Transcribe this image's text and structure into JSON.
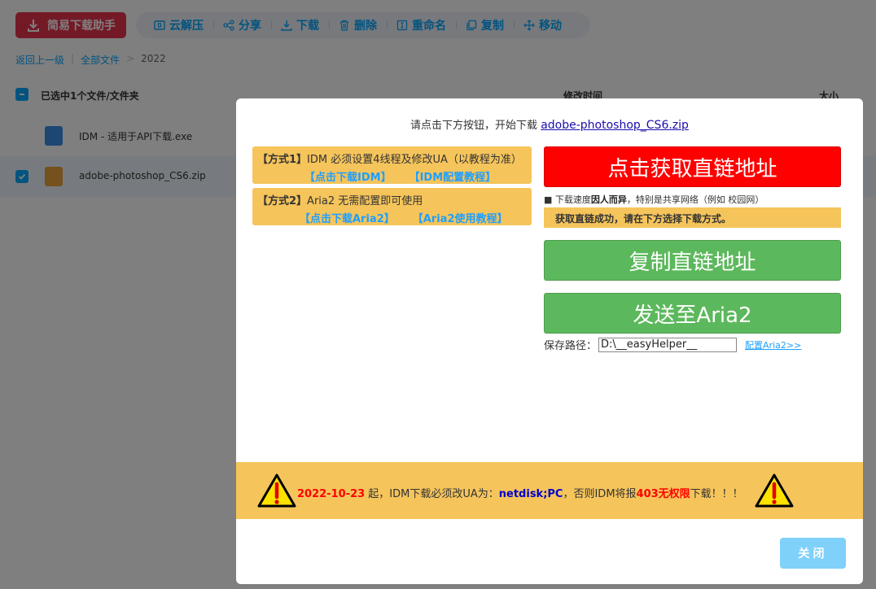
{
  "toolbar": {
    "main_button": "简易下载助手",
    "actions": [
      {
        "label": "云解压",
        "icon": "archive-icon"
      },
      {
        "label": "分享",
        "icon": "share-icon"
      },
      {
        "label": "下载",
        "icon": "download-icon"
      },
      {
        "label": "删除",
        "icon": "trash-icon"
      },
      {
        "label": "重命名",
        "icon": "rename-icon"
      },
      {
        "label": "复制",
        "icon": "copy-icon"
      },
      {
        "label": "移动",
        "icon": "move-icon"
      }
    ]
  },
  "breadcrumb": {
    "back": "返回上一级",
    "sep": "|",
    "all": "全部文件",
    "arrow": ">",
    "current": "2022"
  },
  "list": {
    "selected_text": "已选中1个文件/文件夹",
    "col_mtime": "修改时间",
    "col_size": "大小",
    "files": [
      {
        "name": "IDM - 适用于API下载.exe",
        "selected": false
      },
      {
        "name": "adobe-photoshop_CS6.zip",
        "selected": true
      }
    ]
  },
  "modal": {
    "prompt": "请点击下方按钮，开始下载",
    "filename": "adobe-photoshop_CS6.zip",
    "method1": {
      "tag": "【方式1】",
      "desc": "IDM 必须设置4线程及修改UA（以教程为准）",
      "link_download": "【点击下载IDM】",
      "link_tutorial": "【IDM配置教程】"
    },
    "method2": {
      "tag": "【方式2】",
      "desc": "Aria2 无需配置即可使用",
      "link_download": "【点击下载Aria2】",
      "link_tutorial": "【Aria2使用教程】"
    },
    "get_link_button": "点击获取直链地址",
    "speed_note_prefix": "■ 下载速度",
    "speed_note_bold": "因人而异",
    "speed_note_suffix": "，特别是共享网络（例如 校园网）",
    "success_text": "获取直链成功，请在下方选择下载方式。",
    "copy_link_button": "复制直链地址",
    "send_aria2_button": "发送至Aria2",
    "save_path_label": "保存路径：",
    "save_path_value": "D:\\__easyHelper__",
    "config_aria2_link": "配置Aria2>>",
    "warning": {
      "date": "2022-10-23",
      "text1": " 起，IDM下载必须改UA为：",
      "ua": "netdisk;PC",
      "text2": "，否则IDM将报",
      "error": "403无权限",
      "text3": "下载！！！"
    },
    "close_button": "关闭"
  },
  "colors": {
    "brand_red": "#e8344e",
    "accent_blue": "#06a7ff",
    "warning_yellow": "#f5c45b",
    "button_red": "#ff0000",
    "button_green": "#5cb85c",
    "close_blue": "#7fd1fa"
  }
}
